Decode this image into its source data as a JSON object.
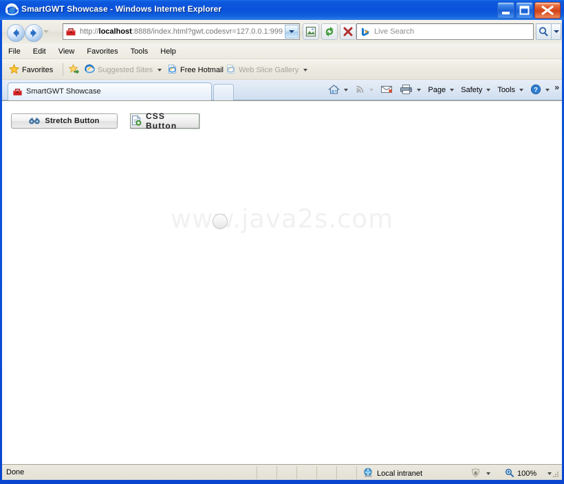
{
  "window": {
    "title": "SmartGWT Showcase - Windows Internet Explorer",
    "icon": "internet-explorer-icon",
    "controls": {
      "minimize": "Minimize",
      "maximize": "Maximize",
      "close": "Close"
    }
  },
  "navigation": {
    "back": "Back",
    "forward": "Forward",
    "recent_pages": "Recent Pages",
    "address": {
      "favicon": "gwt-toolbox-icon",
      "prefix": "http://",
      "host": "localhost",
      "rest": ":8888/index.html?gwt.codesvr=127.0.0.1:999",
      "dropdown": "Address dropdown"
    },
    "compatibility_view": "Compatibility View",
    "refresh": "Refresh",
    "stop": "Stop",
    "search": {
      "provider_icon": "bing-icon",
      "placeholder": "Live Search",
      "go": "Search",
      "dropdown": "Search options"
    }
  },
  "menu": {
    "items": [
      {
        "label": "File"
      },
      {
        "label": "Edit"
      },
      {
        "label": "View"
      },
      {
        "label": "Favorites"
      },
      {
        "label": "Tools"
      },
      {
        "label": "Help"
      }
    ]
  },
  "favorites_bar": {
    "favorites_label": "Favorites",
    "items": [
      {
        "label": "Suggested Sites",
        "icon": "ie-page-icon",
        "dimmed": true,
        "has_caret": true
      },
      {
        "label": "Free Hotmail",
        "icon": "ie-page-icon",
        "dimmed": false,
        "has_caret": false
      },
      {
        "label": "Web Slice Gallery",
        "icon": "ie-page-icon",
        "dimmed": true,
        "has_caret": true
      }
    ]
  },
  "tabs": {
    "active": {
      "label": "SmartGWT Showcase",
      "favicon": "gwt-toolbox-icon"
    },
    "new_tab": "New Tab"
  },
  "command_bar": {
    "home": "Home",
    "feeds": "Feeds",
    "read_mail": "Read Mail",
    "print": "Print",
    "page": "Page",
    "safety": "Safety",
    "tools": "Tools",
    "help": "Help",
    "overflow": "»"
  },
  "page": {
    "watermark": "www.java2s.com",
    "stretch_button": {
      "label": "Stretch Button",
      "icon": "binoculars-icon"
    },
    "css_button": {
      "label": "CSS Button",
      "icon": "document-add-icon"
    },
    "round_button": {
      "label": "",
      "icon": "round-button"
    }
  },
  "status_bar": {
    "message": "Done",
    "zone": "Local intranet",
    "zone_icon": "globe-icon",
    "protected_mode_icon": "shield-icon",
    "zoom_icon": "zoom-icon",
    "zoom_level": "100%"
  },
  "colors": {
    "title_blue": "#0a50da",
    "close_red": "#d1421a",
    "toolbar_beige": "#ece9df",
    "tab_strip": "#dbe6f4",
    "page_white": "#ffffff",
    "watermark_grey": "#f1f1f1"
  }
}
